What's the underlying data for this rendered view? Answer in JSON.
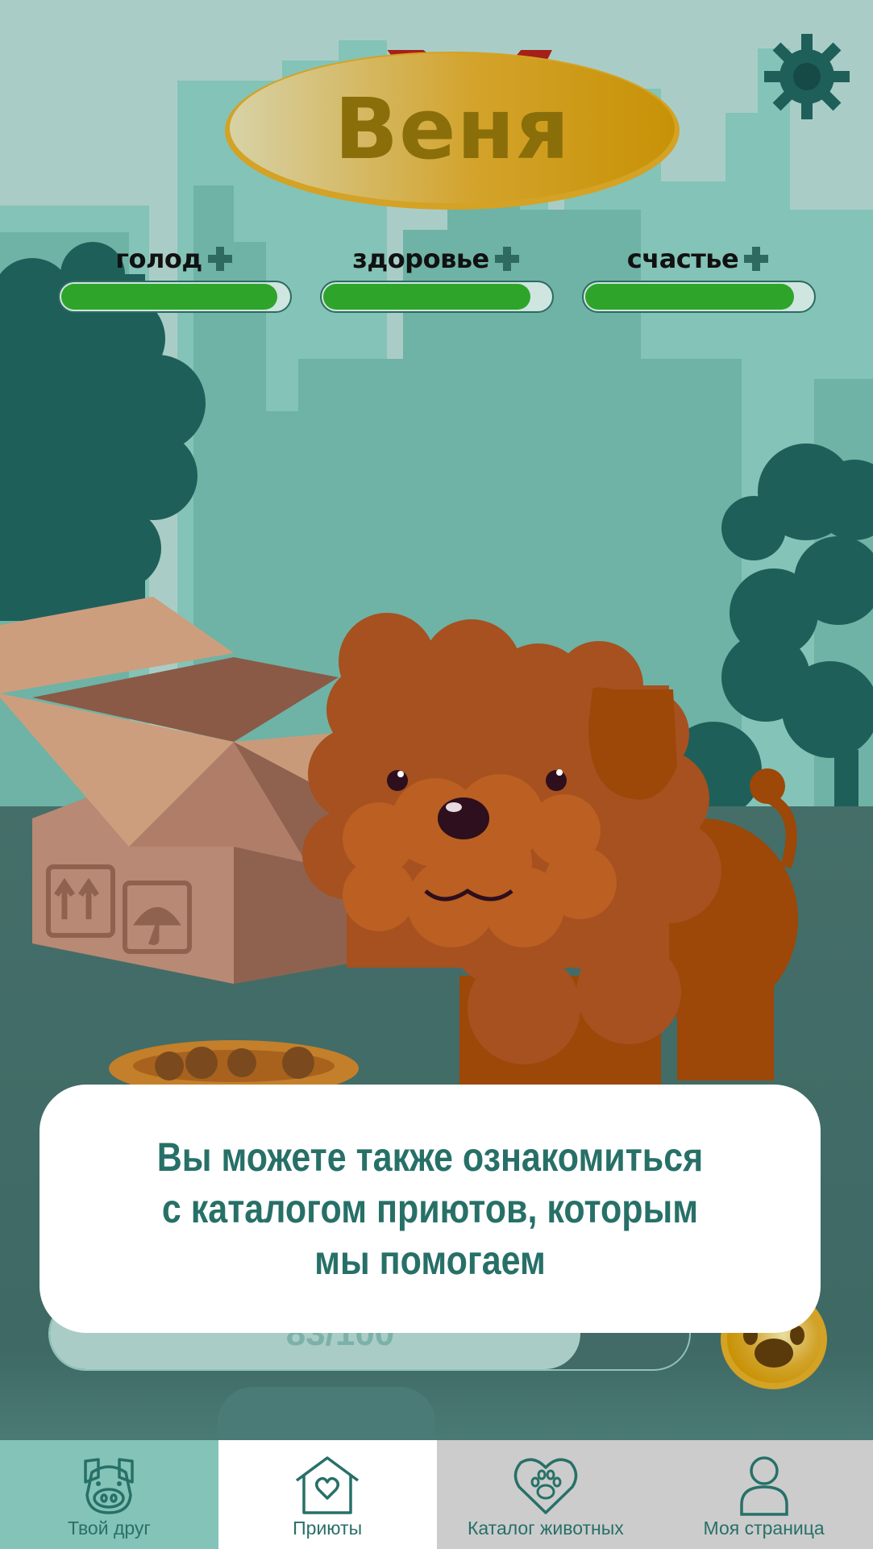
{
  "pet": {
    "name": "Веня"
  },
  "stats": [
    {
      "label": "голод",
      "level": 0.95
    },
    {
      "label": "здоровье",
      "level": 0.91
    },
    {
      "label": "счастье",
      "level": 0.92
    }
  ],
  "dialog": {
    "text": "Вы можете также ознакомиться с каталогом приютов, которым мы помогаем"
  },
  "xp": {
    "text": "83/100",
    "value": 83,
    "max": 100
  },
  "nav": {
    "items": [
      {
        "label": "Твой друг",
        "icon": "pet-face-icon",
        "state": "active"
      },
      {
        "label": "Приюты",
        "icon": "shelter-house-icon",
        "state": "highlighted"
      },
      {
        "label": "Каталог животных",
        "icon": "heart-paw-icon",
        "state": "inactive"
      },
      {
        "label": "Моя страница",
        "icon": "user-profile-icon",
        "state": "inactive"
      }
    ]
  },
  "colors": {
    "sky": "#a9cdc6",
    "accent": "#277068",
    "stat_fill": "#2ea52a",
    "ground": "#426a66",
    "tag_gold": "#d4a224",
    "nav_active": "#84c3b7",
    "nav_highlight": "#ffffff",
    "nav_inactive": "#cccccc"
  }
}
